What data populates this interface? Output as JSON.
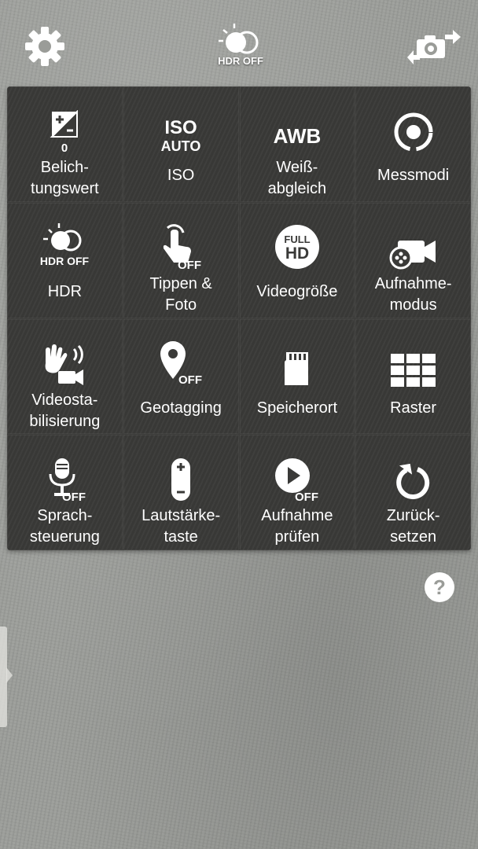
{
  "top_bar": {
    "settings_icon": "gear-icon",
    "hdr_label": "HDR OFF",
    "switch_camera_icon": "camera-switch-icon"
  },
  "settings": [
    {
      "id": "exposure",
      "label": "Belich-\ntungswert",
      "icon": "exposure-icon",
      "badge": "0"
    },
    {
      "id": "iso",
      "label": "ISO",
      "icon": "iso-icon",
      "icon_text": "ISO",
      "icon_subtext": "AUTO"
    },
    {
      "id": "wb",
      "label": "Weiß-\nabgleich",
      "icon": "white-balance-icon",
      "icon_text": "AWB"
    },
    {
      "id": "metering",
      "label": "Messmodi",
      "icon": "metering-icon"
    },
    {
      "id": "hdr",
      "label": "HDR",
      "icon": "hdr-icon",
      "icon_text": "HDR OFF"
    },
    {
      "id": "tap",
      "label": "Tippen &\nFoto",
      "icon": "tap-shot-icon",
      "icon_text": "OFF"
    },
    {
      "id": "videosize",
      "label": "Videogröße",
      "icon": "full-hd-icon",
      "icon_text": "FULL",
      "icon_subtext": "HD"
    },
    {
      "id": "recmode",
      "label": "Aufnahme-\nmodus",
      "icon": "recording-mode-icon"
    },
    {
      "id": "stab",
      "label": "Videosta-\nbilisierung",
      "icon": "video-stabilization-icon"
    },
    {
      "id": "geo",
      "label": "Geotagging",
      "icon": "geotag-icon",
      "icon_text": "OFF"
    },
    {
      "id": "storage",
      "label": "Speicherort",
      "icon": "sd-card-icon"
    },
    {
      "id": "grid",
      "label": "Raster",
      "icon": "grid-icon"
    },
    {
      "id": "voice",
      "label": "Sprach-\nsteuerung",
      "icon": "voice-control-icon",
      "icon_text": "OFF"
    },
    {
      "id": "volkey",
      "label": "Lautstärke-\ntaste",
      "icon": "volume-key-icon"
    },
    {
      "id": "review",
      "label": "Aufnahme\nprüfen",
      "icon": "review-icon",
      "icon_text": "OFF"
    },
    {
      "id": "reset",
      "label": "Zurück-\nsetzen",
      "icon": "reset-icon"
    }
  ],
  "help_icon": "help-icon",
  "colors": {
    "panel": "#3a3a38",
    "text": "#ffffff",
    "background": "#9a9c98"
  }
}
